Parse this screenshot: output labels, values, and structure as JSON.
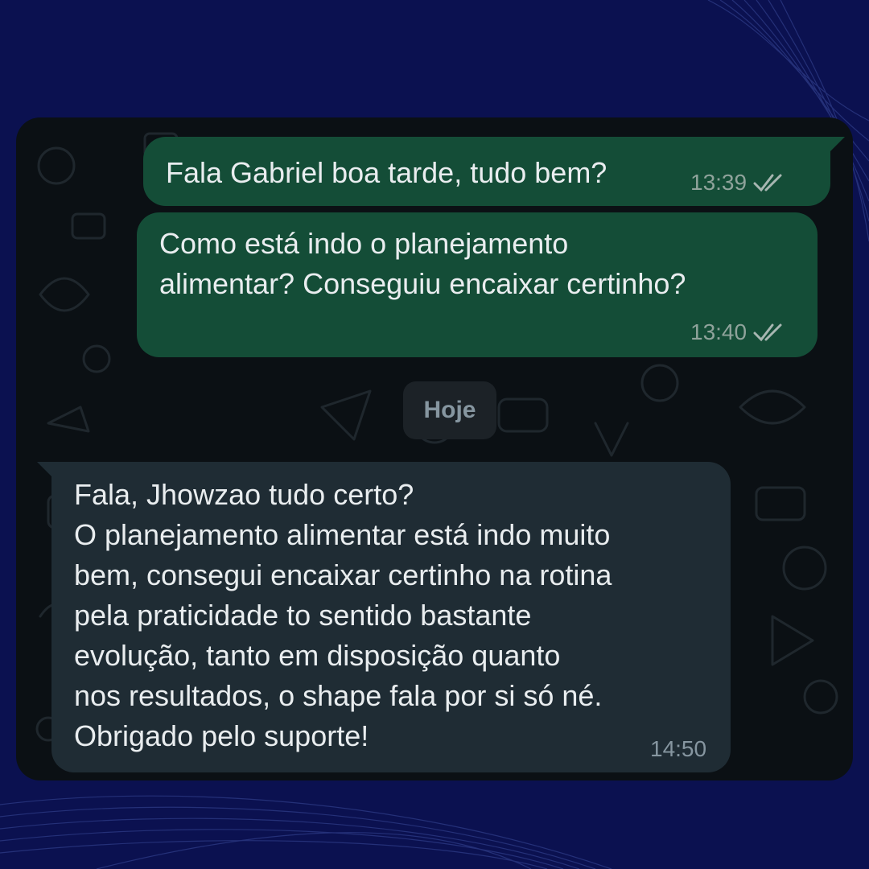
{
  "conversation": {
    "messages": [
      {
        "direction": "outgoing",
        "text": "Fala Gabriel boa tarde, tudo bem?",
        "time": "13:39",
        "status_icon": "double-check-icon"
      },
      {
        "direction": "outgoing",
        "text": "Como está indo o planejamento\nalimentar? Conseguiu encaixar certinho?",
        "time": "13:40",
        "status_icon": "double-check-icon"
      },
      {
        "direction": "incoming",
        "text": "Fala, Jhowzao tudo certo?\nO planejamento alimentar está indo muito\nbem, consegui encaixar certinho na rotina\npela praticidade to sentido bastante\nevolução, tanto em disposição quanto\nnos resultados, o shape fala por si só né.\nObrigado pelo suporte!",
        "time": "14:50"
      }
    ],
    "date_separator": "Hoje"
  },
  "colors": {
    "page_background": "#0b1150",
    "chat_background": "#0b1014",
    "outgoing_bubble": "#144d37",
    "incoming_bubble": "#1f2c34",
    "date_chip": "#1c2227",
    "message_text": "#e9edef",
    "meta_text": "#8696a0"
  }
}
